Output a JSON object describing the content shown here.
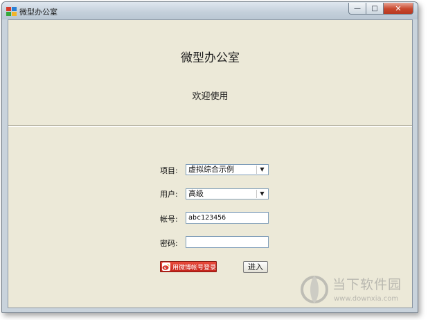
{
  "window": {
    "title": "微型办公室",
    "controls": {
      "minimize": "—",
      "maximize": "□",
      "close": "✕"
    }
  },
  "header": {
    "app_title": "微型办公室",
    "welcome": "欢迎使用"
  },
  "form": {
    "project": {
      "label": "项目:",
      "value": "虚拟综合示例"
    },
    "user": {
      "label": "用户:",
      "value": "高级"
    },
    "account": {
      "label": "帐号:",
      "value": "abc123456"
    },
    "password": {
      "label": "密码:",
      "value": ""
    }
  },
  "buttons": {
    "weibo_login": "用微博帐号登录",
    "enter": "进入"
  },
  "watermark": {
    "name": "当下软件园",
    "url": "www.downxia.com"
  },
  "colors": {
    "client_bg": "#ece9d8",
    "weibo_red": "#d8352a",
    "close_red": "#c8472d"
  }
}
